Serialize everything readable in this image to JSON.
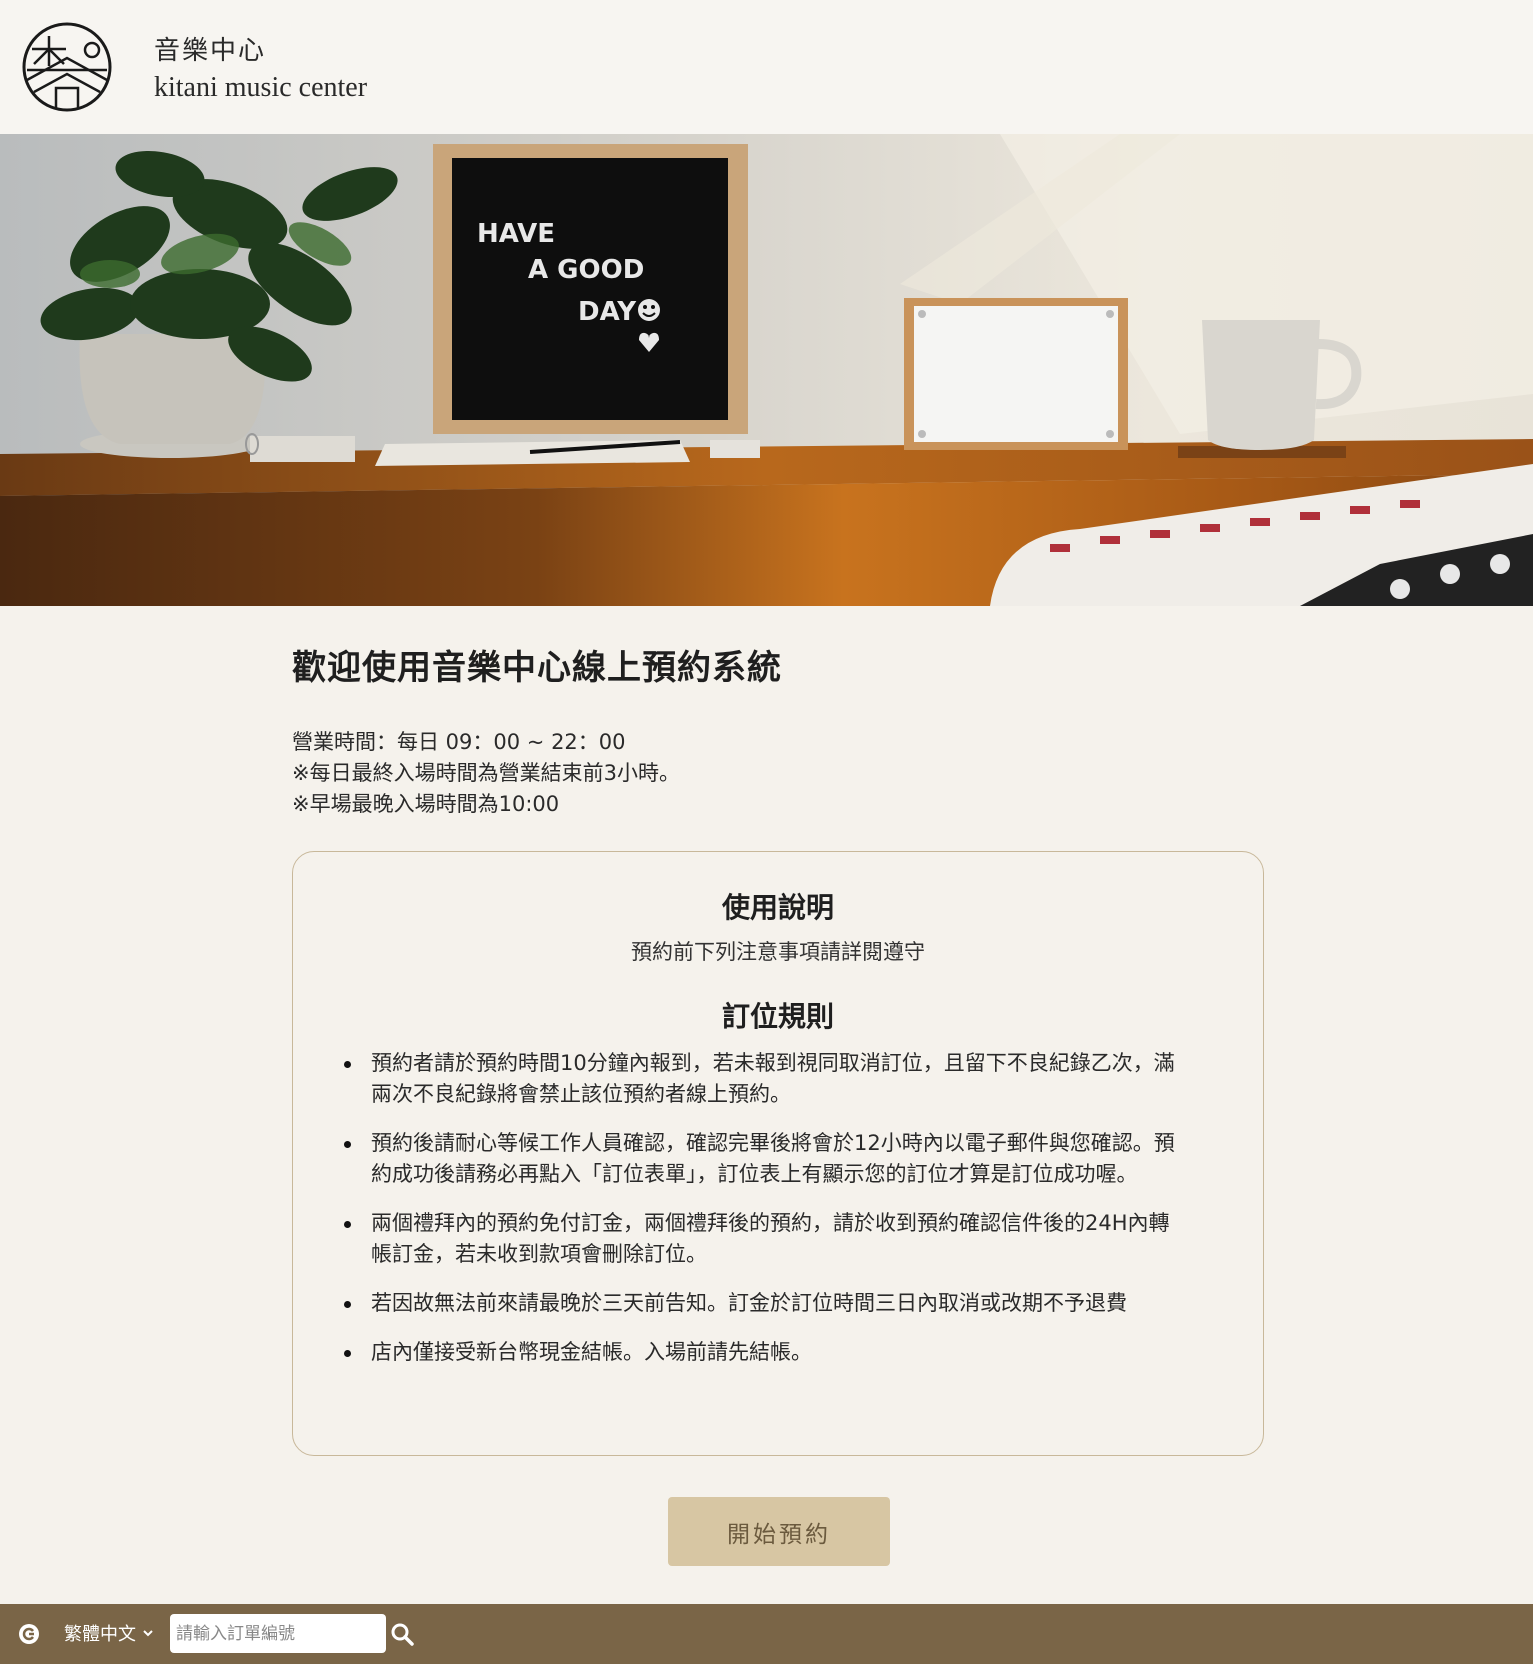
{
  "header": {
    "brand_cn": "音樂中心",
    "brand_en": "kitani music center"
  },
  "hero": {
    "letterboard_lines": [
      "HAVE",
      "A GOOD",
      "DAY"
    ]
  },
  "main": {
    "welcome_title": "歡迎使用音樂中心線上預約系統",
    "hours": [
      "營業時間：每日 09：00 ~ 22：00",
      "※每日最終入場時間為營業結束前3小時。",
      "※早場最晚入場時間為10:00"
    ]
  },
  "rules": {
    "title": "使用說明",
    "subtitle": "預約前下列注意事項請詳閱遵守",
    "heading": "訂位規則",
    "items": [
      "預約者請於預約時間10分鐘內報到，若未報到視同取消訂位，且留下不良紀錄乙次，滿兩次不良紀錄將會禁止該位預約者線上預約。",
      "預約後請耐心等候工作人員確認，確認完畢後將會於12小時內以電子郵件與您確認。預約成功後請務必再點入「訂位表單」，訂位表上有顯示您的訂位才算是訂位成功喔。",
      "兩個禮拜內的預約免付訂金，兩個禮拜後的預約，請於收到預約確認信件後的24H內轉帳訂金，若未收到款項會刪除訂位。",
      "若因故無法前來請最晚於三天前告知。訂金於訂位時間三日內取消或改期不予退費",
      "店內僅接受新台幣現金結帳。入場前請先結帳。"
    ]
  },
  "start_button": "開始預約",
  "footer": {
    "language": "繁體中文",
    "order_placeholder": "請輸入訂單編號",
    "icons": [
      "language-icon",
      "chevron-down-icon",
      "search-icon"
    ]
  },
  "colors": {
    "page_bg": "#f5f2ec",
    "footer_bg": "#7a6547",
    "button_bg": "#d7c6a3",
    "box_border": "#c8b89a"
  }
}
